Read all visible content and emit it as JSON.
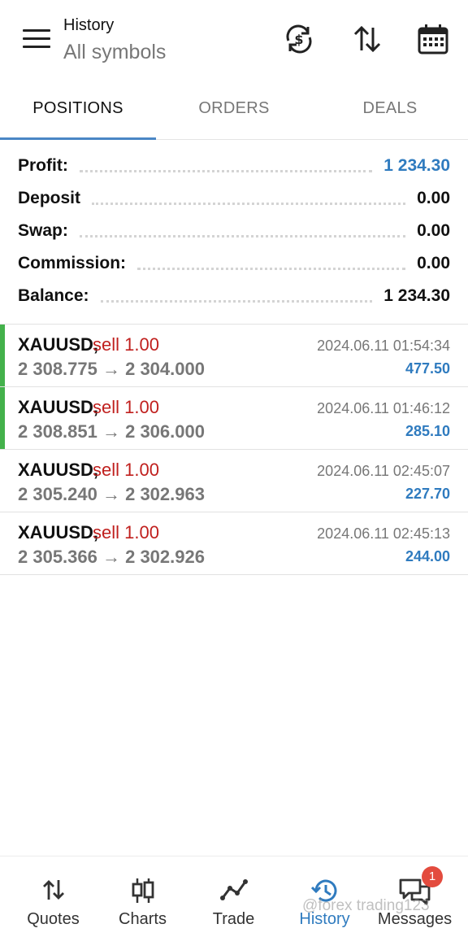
{
  "header": {
    "title": "History",
    "subtitle": "All symbols"
  },
  "tabs": [
    {
      "label": "POSITIONS",
      "active": true
    },
    {
      "label": "ORDERS",
      "active": false
    },
    {
      "label": "DEALS",
      "active": false
    }
  ],
  "summary": [
    {
      "label": "Profit:",
      "value": "1 234.30",
      "highlight": true
    },
    {
      "label": "Deposit",
      "value": "0.00",
      "highlight": false
    },
    {
      "label": "Swap:",
      "value": "0.00",
      "highlight": false
    },
    {
      "label": "Commission:",
      "value": "0.00",
      "highlight": false
    },
    {
      "label": "Balance:",
      "value": "1 234.30",
      "highlight": false
    }
  ],
  "deals": [
    {
      "symbol": "XAUUSD,",
      "side": "sell 1.00",
      "prices": "2 308.775 → 2 304.000",
      "time": "2024.06.11 01:54:34",
      "profit": "477.50",
      "marked": true
    },
    {
      "symbol": "XAUUSD,",
      "side": "sell 1.00",
      "prices": "2 308.851 → 2 306.000",
      "time": "2024.06.11 01:46:12",
      "profit": "285.10",
      "marked": true
    },
    {
      "symbol": "XAUUSD,",
      "side": "sell 1.00",
      "prices": "2 305.240 → 2 302.963",
      "time": "2024.06.11 02:45:07",
      "profit": "227.70",
      "marked": false
    },
    {
      "symbol": "XAUUSD,",
      "side": "sell 1.00",
      "prices": "2 305.366 → 2 302.926",
      "time": "2024.06.11 02:45:13",
      "profit": "244.00",
      "marked": false
    }
  ],
  "bottom_nav": [
    {
      "label": "Quotes",
      "icon": "quotes-icon",
      "active": false
    },
    {
      "label": "Charts",
      "icon": "charts-icon",
      "active": false
    },
    {
      "label": "Trade",
      "icon": "trade-icon",
      "active": false
    },
    {
      "label": "History",
      "icon": "history-icon",
      "active": true
    },
    {
      "label": "Messages",
      "icon": "messages-icon",
      "active": false,
      "badge": "1"
    }
  ],
  "watermark": "@forex trading123",
  "colors": {
    "accent": "#2f7bbf",
    "sell": "#c0201e",
    "marker": "#43b14b",
    "badge": "#e34b3e"
  }
}
